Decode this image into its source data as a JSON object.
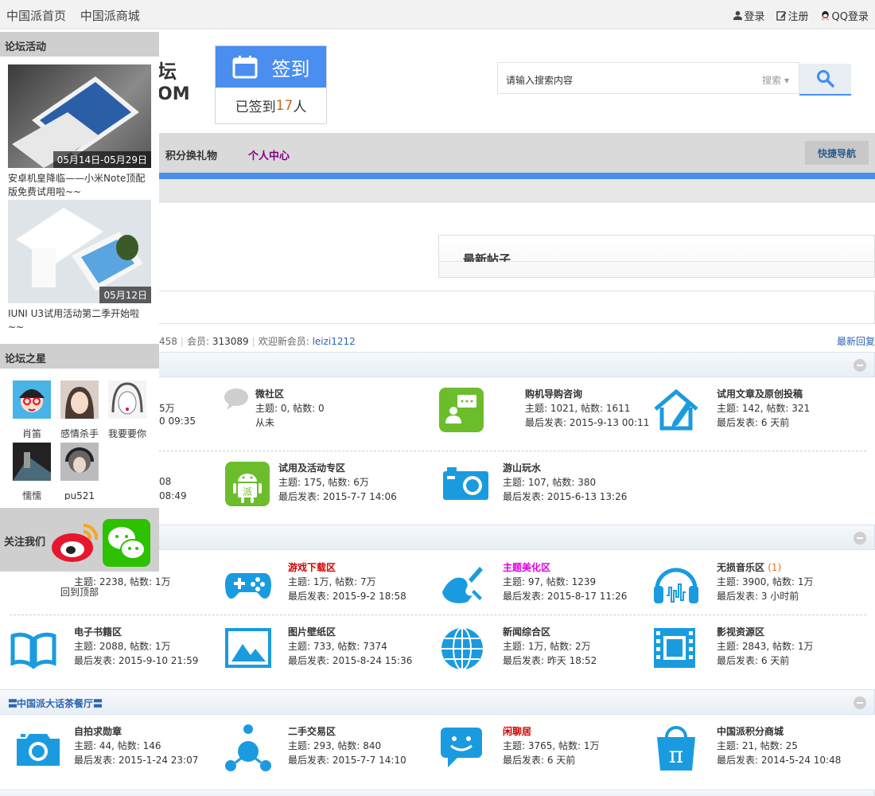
{
  "topbar": {
    "links": [
      "中国派首页",
      "中国派商城"
    ],
    "login": "登录",
    "register": "注册",
    "qq_login": "QQ登录"
  },
  "header": {
    "logo_text": "坛",
    "logo_domain": "OM",
    "signin_label": "签到",
    "signed_prefix": "已签到",
    "signed_count": "17",
    "signed_suffix": "人",
    "search_placeholder": "请输入搜索内容",
    "search_type": "搜索"
  },
  "nav": {
    "items": [
      "积分换礼物",
      "个人中心"
    ],
    "quick_nav": "快捷导航"
  },
  "latest": {
    "title": "最新帖子"
  },
  "stats": {
    "posts_tail": "458",
    "members_label": "会员:",
    "members": "313089",
    "welcome_label": "欢迎新会员:",
    "new_member": "leizi1212",
    "latest_reply": "最新回复"
  },
  "sidebar": {
    "activity_title": "论坛活动",
    "activities": [
      {
        "date": "05月14日-05月29日",
        "caption": "安卓机皇降临——小米Note顶配版免费试用啦~~"
      },
      {
        "date": "05月12日",
        "caption": "IUNI U3试用活动第二季开始啦~~"
      }
    ],
    "stars_title": "论坛之星",
    "stars": [
      "肖笛",
      "感情杀手",
      "我要要你",
      "懦懦",
      "pu521"
    ],
    "follow_title": "关注我们",
    "back_to_top": "回到顶部"
  },
  "section1": {
    "rows": [
      [
        {
          "name": "",
          "l2": "5万",
          "l3": "0 09:35"
        },
        {
          "name": "微社区",
          "l2": "主题: 0, 帖数: 0",
          "l3": "从未"
        },
        {
          "name": "购机导购咨询",
          "l2": "主题: 1021, 帖数: 1611",
          "l3": "最后发表: 2015-9-13 00:11"
        },
        {
          "name": "试用文章及原创投稿",
          "l2": "主题: 142, 帖数: 321",
          "l3": "最后发表: 6 天前"
        }
      ],
      [
        {
          "name": "",
          "l2": "08",
          "l3": "08:49"
        },
        {
          "name": "试用及活动专区",
          "l2": "主题: 175, 帖数: 6万",
          "l3": "最后发表: 2015-7-7 14:06"
        },
        {
          "name": "游山玩水",
          "l2": "主题: 107, 帖数: 380",
          "l3": "最后发表: 2015-6-13 13:26"
        }
      ]
    ]
  },
  "section2": {
    "rows": [
      [
        {
          "name": "",
          "l2": "主题: 2238, 帖数: 1万",
          "l3": ""
        },
        {
          "name": "游戏下载区",
          "l2": "主题: 1万, 帖数: 7万",
          "l3": "最后发表: 2015-9-2 18:58"
        },
        {
          "name": "主题美化区",
          "l2": "主题: 97, 帖数: 1239",
          "l3": "最后发表: 2015-8-17 11:26"
        },
        {
          "name": "无损音乐区",
          "new": "(1)",
          "l2": "主题: 3900, 帖数: 1万",
          "l3": "最后发表: 3 小时前"
        }
      ],
      [
        {
          "name": "电子书籍区",
          "l2": "主题: 2088, 帖数: 1万",
          "l3": "最后发表: 2015-9-10 21:59"
        },
        {
          "name": "图片壁纸区",
          "l2": "主题: 733, 帖数: 7374",
          "l3": "最后发表: 2015-8-24 15:36"
        },
        {
          "name": "新闻综合区",
          "l2": "主题: 1万, 帖数: 2万",
          "l3": "最后发表: 昨天 18:52"
        },
        {
          "name": "影视资源区",
          "l2": "主题: 2843, 帖数: 1万",
          "l3": "最后发表: 6 天前"
        }
      ]
    ]
  },
  "section3": {
    "title": "中国派大话茶餐厅",
    "rows": [
      [
        {
          "name": "自拍求勋章",
          "l2": "主题: 44, 帖数: 146",
          "l3": "最后发表: 2015-1-24 23:07"
        },
        {
          "name": "二手交易区",
          "l2": "主题: 293, 帖数: 840",
          "l3": "最后发表: 2015-7-7 14:10"
        },
        {
          "name": "闲聊居",
          "l2": "主题: 3765, 帖数: 1万",
          "l3": "最后发表: 6 天前"
        },
        {
          "name": "中国派积分商城",
          "l2": "主题: 21, 帖数: 25",
          "l3": "最后发表: 2014-5-24 10:48"
        }
      ]
    ]
  },
  "colors": {
    "accent": "#4a8ef0",
    "icon_blue": "#1a9be0",
    "red_name": "#d40000",
    "pink_name": "#e000e0",
    "purple_nav": "#800080"
  }
}
